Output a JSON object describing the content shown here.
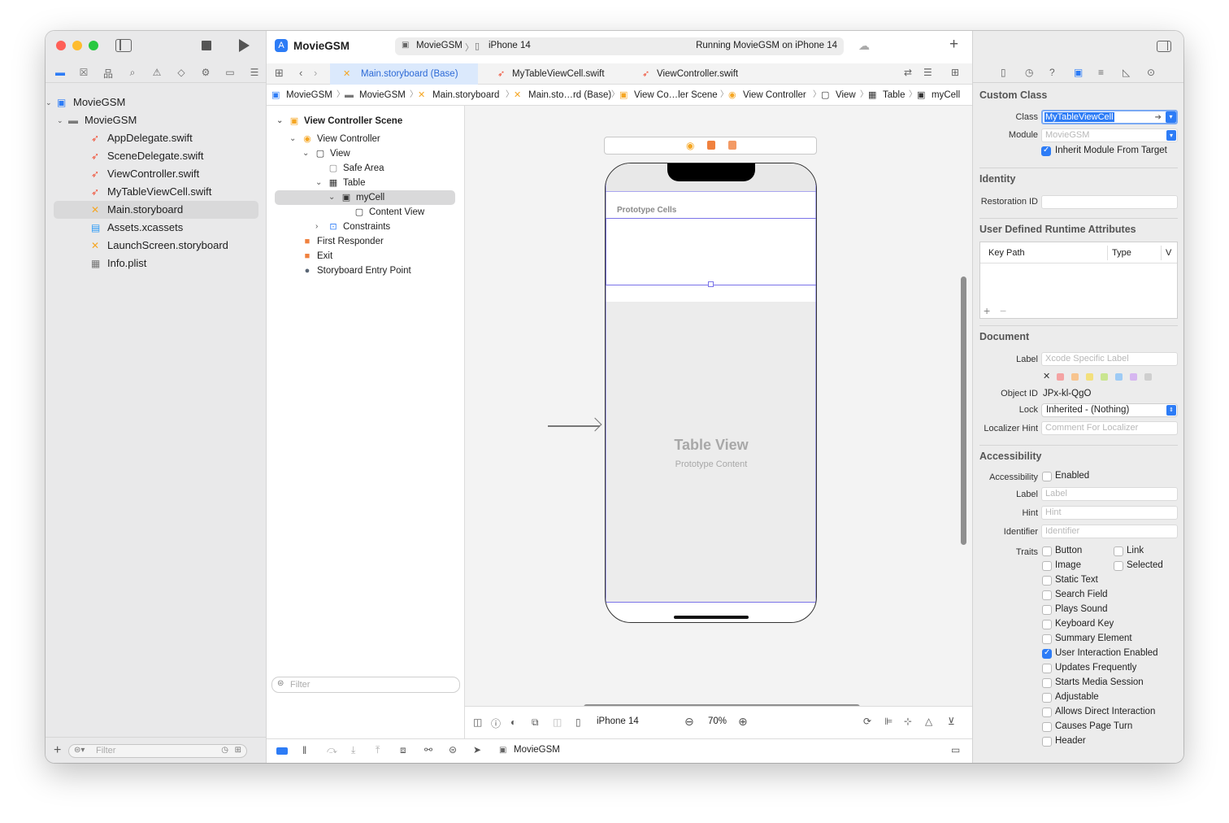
{
  "project": {
    "name": "MovieGSM",
    "scheme": "MovieGSM",
    "device": "iPhone 14",
    "status": "Running MovieGSM on iPhone 14"
  },
  "navigator": {
    "items": [
      {
        "label": "MovieGSM",
        "icon": "app-project-icon"
      },
      {
        "label": "MovieGSM",
        "icon": "folder-icon"
      },
      {
        "label": "AppDelegate.swift",
        "icon": "swift-file-icon"
      },
      {
        "label": "SceneDelegate.swift",
        "icon": "swift-file-icon"
      },
      {
        "label": "ViewController.swift",
        "icon": "swift-file-icon"
      },
      {
        "label": "MyTableViewCell.swift",
        "icon": "swift-file-icon"
      },
      {
        "label": "Main.storyboard",
        "icon": "storyboard-icon"
      },
      {
        "label": "Assets.xcassets",
        "icon": "assets-icon"
      },
      {
        "label": "LaunchScreen.storyboard",
        "icon": "storyboard-icon"
      },
      {
        "label": "Info.plist",
        "icon": "plist-icon"
      }
    ],
    "filter_placeholder": "Filter"
  },
  "tabs": [
    {
      "label": "Main.storyboard (Base)",
      "active": true
    },
    {
      "label": "MyTableViewCell.swift",
      "active": false
    },
    {
      "label": "ViewController.swift",
      "active": false
    }
  ],
  "jumpbar": [
    "MovieGSM",
    "MovieGSM",
    "Main.storyboard",
    "Main.sto…rd (Base)",
    "View Co…ler Scene",
    "View Controller",
    "View",
    "Table",
    "myCell"
  ],
  "outline": {
    "items": [
      {
        "label": "View Controller Scene"
      },
      {
        "label": "View Controller"
      },
      {
        "label": "View"
      },
      {
        "label": "Safe Area"
      },
      {
        "label": "Table"
      },
      {
        "label": "myCell"
      },
      {
        "label": "Content View"
      },
      {
        "label": "Constraints"
      },
      {
        "label": "First Responder"
      },
      {
        "label": "Exit"
      },
      {
        "label": "Storyboard Entry Point"
      }
    ],
    "filter_placeholder": "Filter"
  },
  "canvas": {
    "prototype_cells": "Prototype Cells",
    "table_title": "Table View",
    "table_subtitle": "Prototype Content",
    "device": "iPhone 14",
    "zoom": "70%"
  },
  "debug": {
    "target": "MovieGSM"
  },
  "inspector": {
    "custom_class": {
      "title": "Custom Class",
      "class_label": "Class",
      "class_value": "MyTableViewCell",
      "module_label": "Module",
      "module_placeholder": "MovieGSM",
      "inherit_label": "Inherit Module From Target"
    },
    "identity": {
      "title": "Identity",
      "restoration_label": "Restoration ID"
    },
    "udra": {
      "title": "User Defined Runtime Attributes",
      "col_keypath": "Key Path",
      "col_type": "Type",
      "col_value": "V"
    },
    "document": {
      "title": "Document",
      "label_label": "Label",
      "label_placeholder": "Xcode Specific Label",
      "objectid_label": "Object ID",
      "objectid_value": "JPx-kl-QgO",
      "lock_label": "Lock",
      "lock_value": "Inherited - (Nothing)",
      "hint_label": "Localizer Hint",
      "hint_placeholder": "Comment For Localizer"
    },
    "accessibility": {
      "title": "Accessibility",
      "acc_label": "Accessibility",
      "enabled_label": "Enabled",
      "label_label": "Label",
      "label_placeholder": "Label",
      "hint_label": "Hint",
      "hint_placeholder": "Hint",
      "identifier_label": "Identifier",
      "identifier_placeholder": "Identifier",
      "traits_label": "Traits",
      "traits": [
        {
          "label": "Button",
          "checked": false
        },
        {
          "label": "Link",
          "checked": false
        },
        {
          "label": "Image",
          "checked": false
        },
        {
          "label": "Selected",
          "checked": false
        },
        {
          "label": "Static Text",
          "checked": false
        },
        {
          "label": "Search Field",
          "checked": false
        },
        {
          "label": "Plays Sound",
          "checked": false
        },
        {
          "label": "Keyboard Key",
          "checked": false
        },
        {
          "label": "Summary Element",
          "checked": false
        },
        {
          "label": "User Interaction Enabled",
          "checked": true
        },
        {
          "label": "Updates Frequently",
          "checked": false
        },
        {
          "label": "Starts Media Session",
          "checked": false
        },
        {
          "label": "Adjustable",
          "checked": false
        },
        {
          "label": "Allows Direct Interaction",
          "checked": false
        },
        {
          "label": "Causes Page Turn",
          "checked": false
        },
        {
          "label": "Header",
          "checked": false
        }
      ]
    }
  },
  "colors": {
    "accent": "#2d7cf6",
    "swift": "#f05138",
    "storyboard": "#f5a623",
    "close": "#ff5f57",
    "minimize": "#febc2e",
    "zoom": "#28c840"
  }
}
